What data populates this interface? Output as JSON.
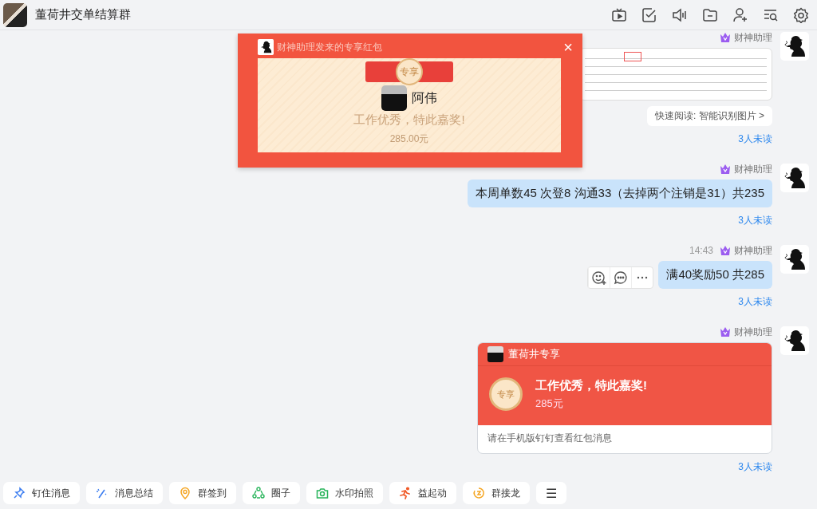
{
  "header": {
    "title": "董荷井交单结算群"
  },
  "messages": [
    {
      "kind": "image",
      "sender": "财神助理",
      "quick_read": "快速阅读: 智能识别图片 >",
      "unread": "3人未读"
    },
    {
      "kind": "text",
      "sender": "财神助理",
      "text": "本周单数45 次登8 沟通33（去掉两个注销是31）共235",
      "unread": "3人未读",
      "show_actions": false
    },
    {
      "kind": "text",
      "sender": "财神助理",
      "time": "14:43",
      "text": "满40奖励50 共285",
      "unread": "3人未读",
      "show_actions": true
    },
    {
      "kind": "red_packet",
      "sender": "财神助理",
      "card_title": "董荷井专享",
      "badge": "专享",
      "headline": "工作优秀，特此嘉奖!",
      "amount": "285元",
      "footer": "请在手机版钉钉查看红包消息",
      "unread": "3人未读"
    }
  ],
  "popup": {
    "title": "财神助理发来的专享红包",
    "close": "×",
    "badge": "专享",
    "name": "阿伟",
    "message": "工作优秀，特此嘉奖!",
    "amount": "285.00元"
  },
  "toolbar": [
    {
      "kind": "pin",
      "label": "钉住消息"
    },
    {
      "kind": "wand",
      "label": "消息总结"
    },
    {
      "kind": "location",
      "label": "群签到"
    },
    {
      "kind": "circle",
      "label": "圈子"
    },
    {
      "kind": "camera",
      "label": "水印拍照"
    },
    {
      "kind": "runner",
      "label": "益起动"
    },
    {
      "kind": "dragon",
      "label": "群接龙"
    },
    {
      "kind": "menu",
      "label": "☰"
    }
  ]
}
